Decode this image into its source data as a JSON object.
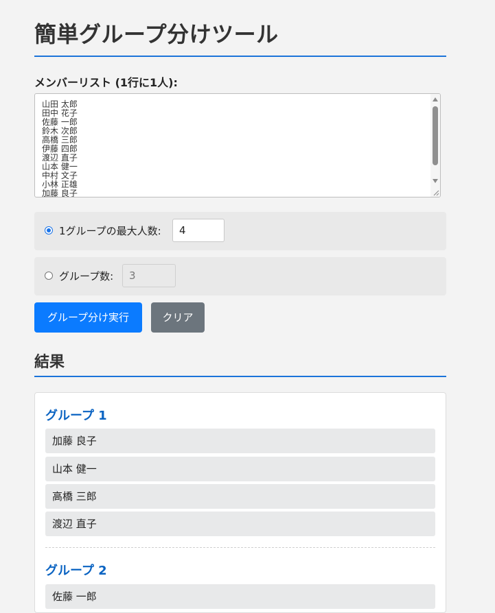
{
  "page": {
    "title": "簡単グループ分けツール"
  },
  "member_list": {
    "label": "メンバーリスト (1行に1人):",
    "lines": [
      "山田 太郎",
      "田中 花子",
      "佐藤 一郎",
      "鈴木 次郎",
      "高橋 三郎",
      "伊藤 四郎",
      "渡辺 直子",
      "山本 健一",
      "中村 文子",
      "小林 正雄",
      "加藤 良子"
    ]
  },
  "options": {
    "max_per_group": {
      "label": "1グループの最大人数:",
      "value": "4",
      "selected": true
    },
    "group_count": {
      "label": "グループ数:",
      "value": "3",
      "selected": false
    }
  },
  "buttons": {
    "run_label": "グループ分け実行",
    "clear_label": "クリア"
  },
  "results": {
    "heading": "結果",
    "groups": [
      {
        "title": "グループ 1",
        "members": [
          "加藤 良子",
          "山本 健一",
          "高橋 三郎",
          "渡辺 直子"
        ]
      },
      {
        "title": "グループ 2",
        "members": [
          "佐藤 一郎"
        ]
      }
    ]
  },
  "colors": {
    "accent": "#1a73d9",
    "primary_button": "#0b7bff",
    "secondary_button": "#6c757d",
    "group_title": "#0a63c2",
    "background": "#f3f3f3"
  },
  "icons": {
    "scroll_up": "triangle-up-icon",
    "scroll_down": "triangle-down-icon",
    "resize": "resize-grip-icon"
  }
}
